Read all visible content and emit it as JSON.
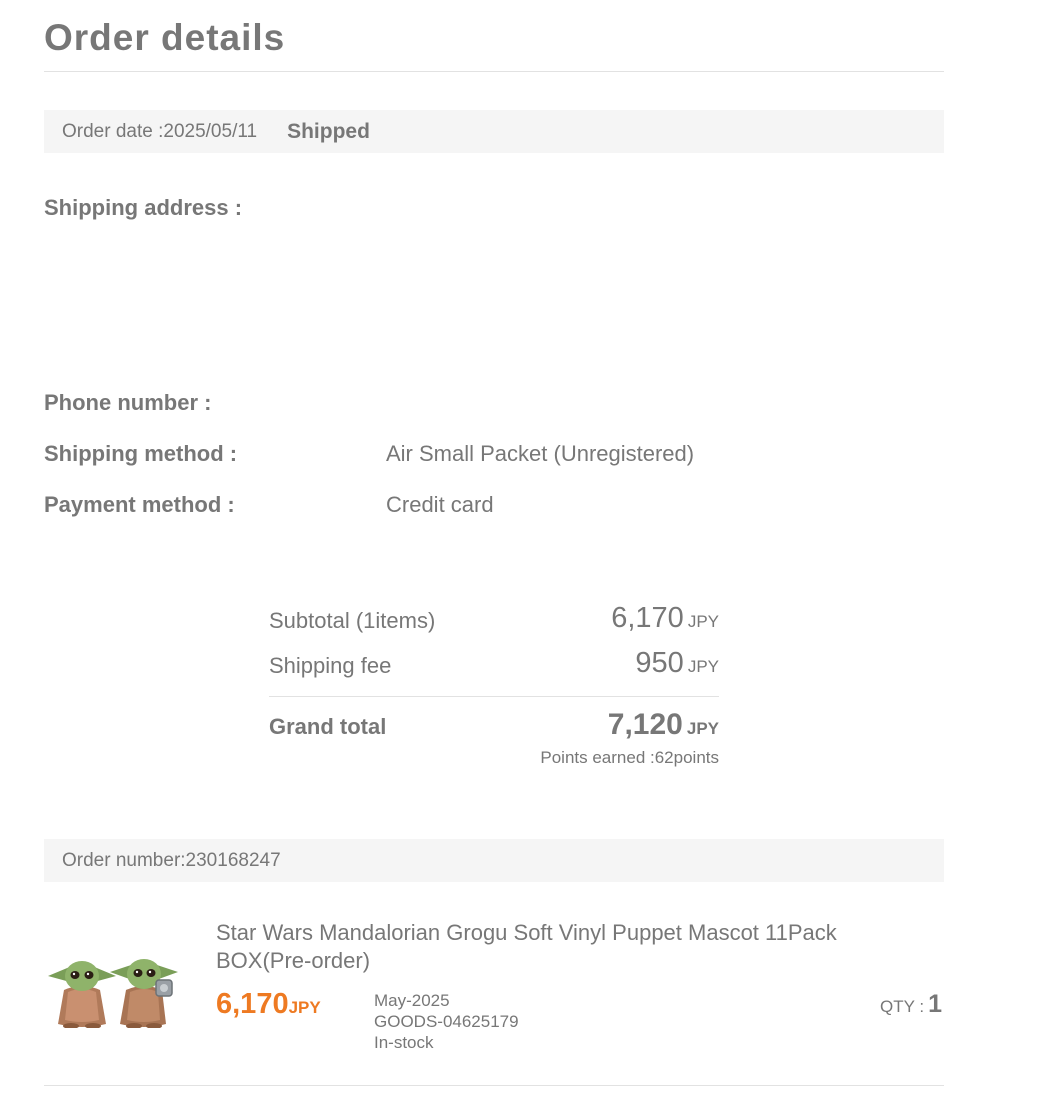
{
  "page": {
    "title": "Order details"
  },
  "status_bar": {
    "order_date": "Order date :2025/05/11",
    "status": "Shipped"
  },
  "shipping": {
    "address_label": "Shipping address :",
    "phone_label": "Phone number :",
    "method_label": "Shipping method :",
    "method_value": "Air Small Packet (Unregistered)",
    "payment_label": "Payment method :",
    "payment_value": "Credit card"
  },
  "summary": {
    "subtotal_label": "Subtotal (1items)",
    "subtotal_value": "6,170",
    "shipping_fee_label": "Shipping fee",
    "shipping_fee_value": "950",
    "grand_total_label": "Grand total",
    "grand_total_value": "7,120",
    "currency": "JPY",
    "points_earned": "Points earned :62points"
  },
  "order": {
    "number": "Order number:230168247",
    "items": [
      {
        "name": "Star Wars Mandalorian Grogu Soft Vinyl Puppet Mascot 11Pack BOX(Pre-order)",
        "price": "6,170",
        "currency": "JPY",
        "release": "May-2025",
        "code": "GOODS-04625179",
        "stock": "In-stock",
        "qty_label": "QTY :",
        "qty": "1"
      }
    ]
  },
  "colors": {
    "accent": "#ee7a22",
    "text": "#777777",
    "panel": "#f5f5f5",
    "rule": "#e2e2e2"
  }
}
